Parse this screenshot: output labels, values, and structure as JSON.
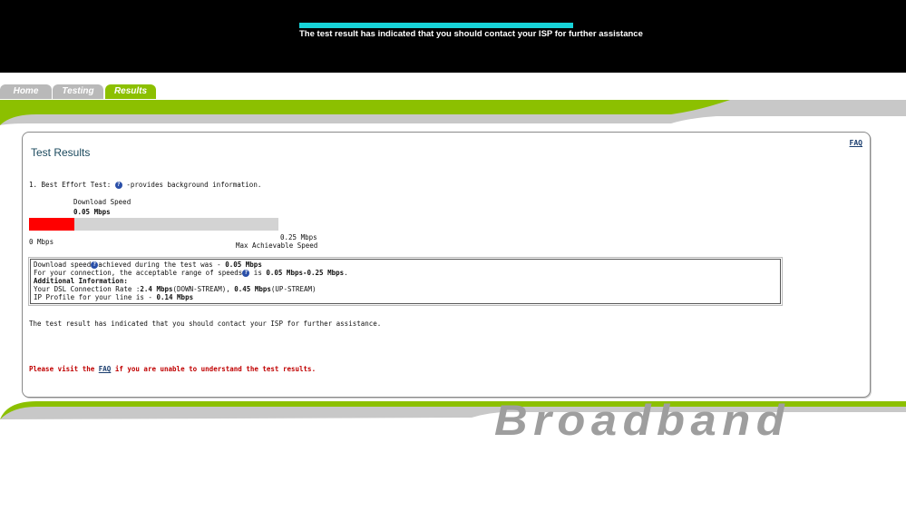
{
  "banner": {
    "message": "The test result has indicated that you should contact your ISP for further assistance",
    "accent_color": "#17d3d8"
  },
  "tabs": [
    {
      "label": "Home",
      "active": false
    },
    {
      "label": "Testing",
      "active": false
    },
    {
      "label": "Results",
      "active": true
    }
  ],
  "colors": {
    "brand_green": "#8cc000",
    "speed_bar": "#ff0000",
    "link": "#1a3d6e",
    "warning": "#c00000"
  },
  "panel": {
    "faq_link": "FAQ",
    "title": "Test Results",
    "intro_prefix": "1. Best Effort Test:",
    "help_icon": "question-mark-icon",
    "intro_suffix": " -provides background information.",
    "download_label": "Download  Speed",
    "download_value": "0.05 Mbps",
    "bar": {
      "value_mbps": 0.05,
      "max_mbps": 0.25,
      "fill_fraction": 0.18
    },
    "scale_min": "0 Mbps",
    "scale_max": "0.25 Mbps",
    "scale_max_label": "Max Achievable Speed",
    "info": {
      "l1_prefix": "Download speed",
      "l1_mid": "achieved during the test was - ",
      "l1_value": "0.05 Mbps",
      "l2_prefix": "For your connection, the acceptable range of speeds",
      "l2_mid": " is ",
      "l2_value": "0.05 Mbps-0.25 Mbps",
      "l2_end": ".",
      "l3_heading": "Additional Information:",
      "l4_prefix": "Your DSL Connection Rate :",
      "l4_down": "2.4 Mbps",
      "l4_down_label": "(DOWN-STREAM), ",
      "l4_up": "0.45 Mbps",
      "l4_up_label": "(UP-STREAM)",
      "l5_prefix": "IP Profile for your line is - ",
      "l5_value": "0.14 Mbps"
    },
    "assistance_text": "The test result has indicated that you should contact your ISP for further assistance.",
    "visit_prefix": "Please visit the ",
    "visit_link": "FAQ",
    "visit_suffix": " if you are unable to understand the test results."
  },
  "brand_text": "Broadband"
}
